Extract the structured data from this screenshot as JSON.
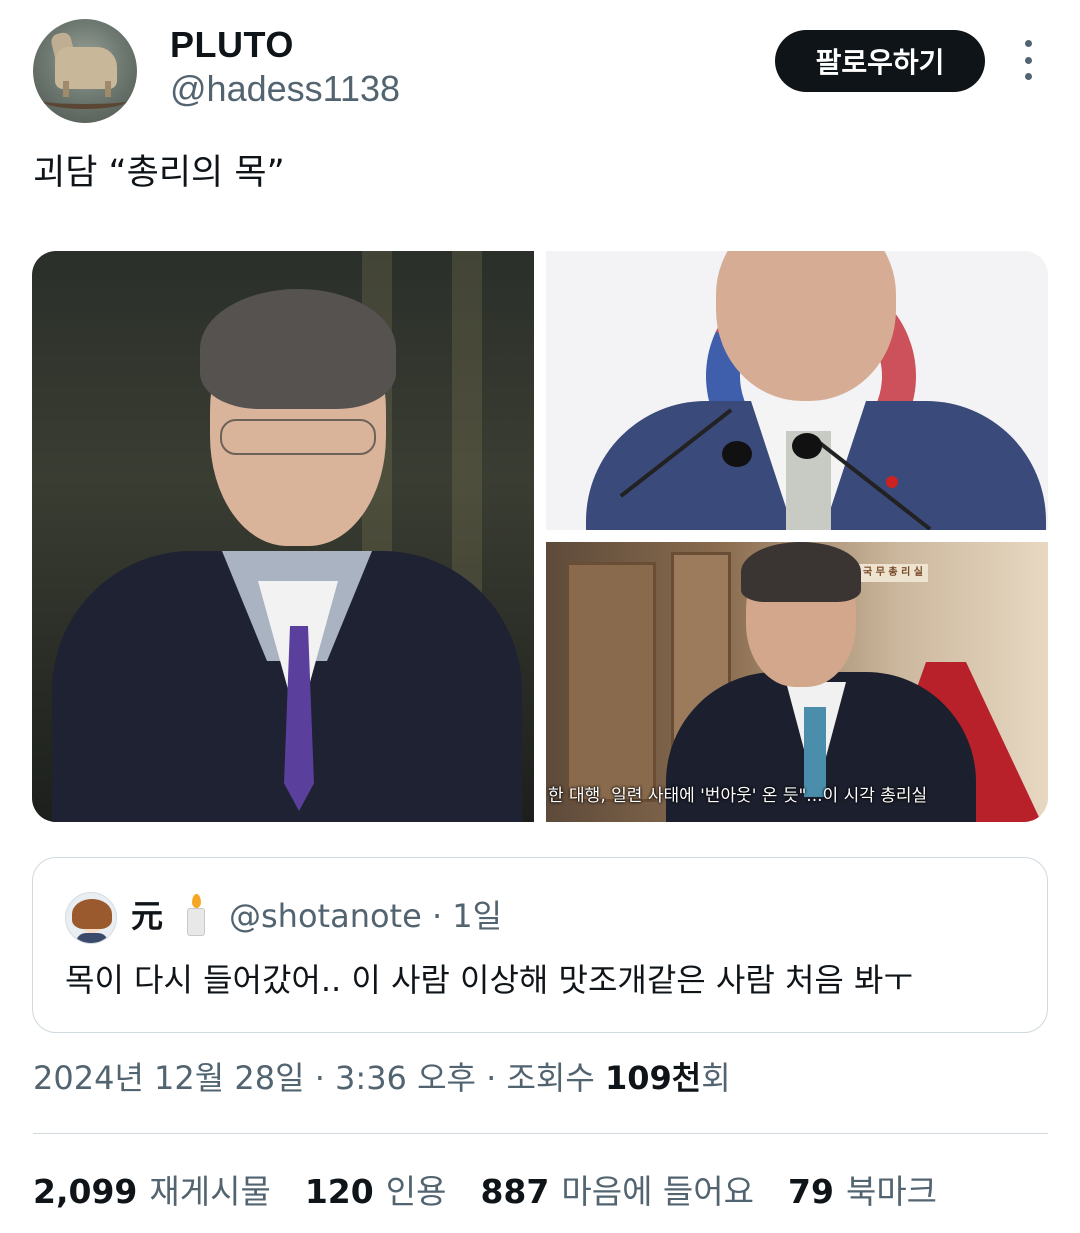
{
  "user": {
    "display_name": "PLUTO",
    "handle": "@hadess1138",
    "follow_label": "팔로우하기"
  },
  "tweet": {
    "text": "괴담 “총리의 목”",
    "media_caption": "한 대행, 일련 사태에 '번아웃' 온 듯\"...이 시각 총리실",
    "sign_text": "국 무 총 리 실"
  },
  "quote": {
    "name": "元",
    "handle": "@shotanote · 1일",
    "text": "목이 다시 들어갔어.. 이 사람 이상해 맛조개같은 사람 처음 봐ㅜ"
  },
  "meta": {
    "timestamp": "2024년 12월 28일 · 3:36 오후 · 조회수 ",
    "views_number": "109천",
    "views_suffix": "회"
  },
  "stats": [
    {
      "number": "2,099",
      "label": "재게시물"
    },
    {
      "number": "120",
      "label": "인용"
    },
    {
      "number": "887",
      "label": "마음에 들어요"
    },
    {
      "number": "79",
      "label": "북마크"
    }
  ],
  "colors": {
    "text_primary": "#0f1419",
    "text_secondary": "#536471",
    "border": "#cfd9de",
    "button_bg": "#0f1419"
  },
  "icons": {
    "more": "more-vertical-icon",
    "candle": "candle-icon"
  }
}
